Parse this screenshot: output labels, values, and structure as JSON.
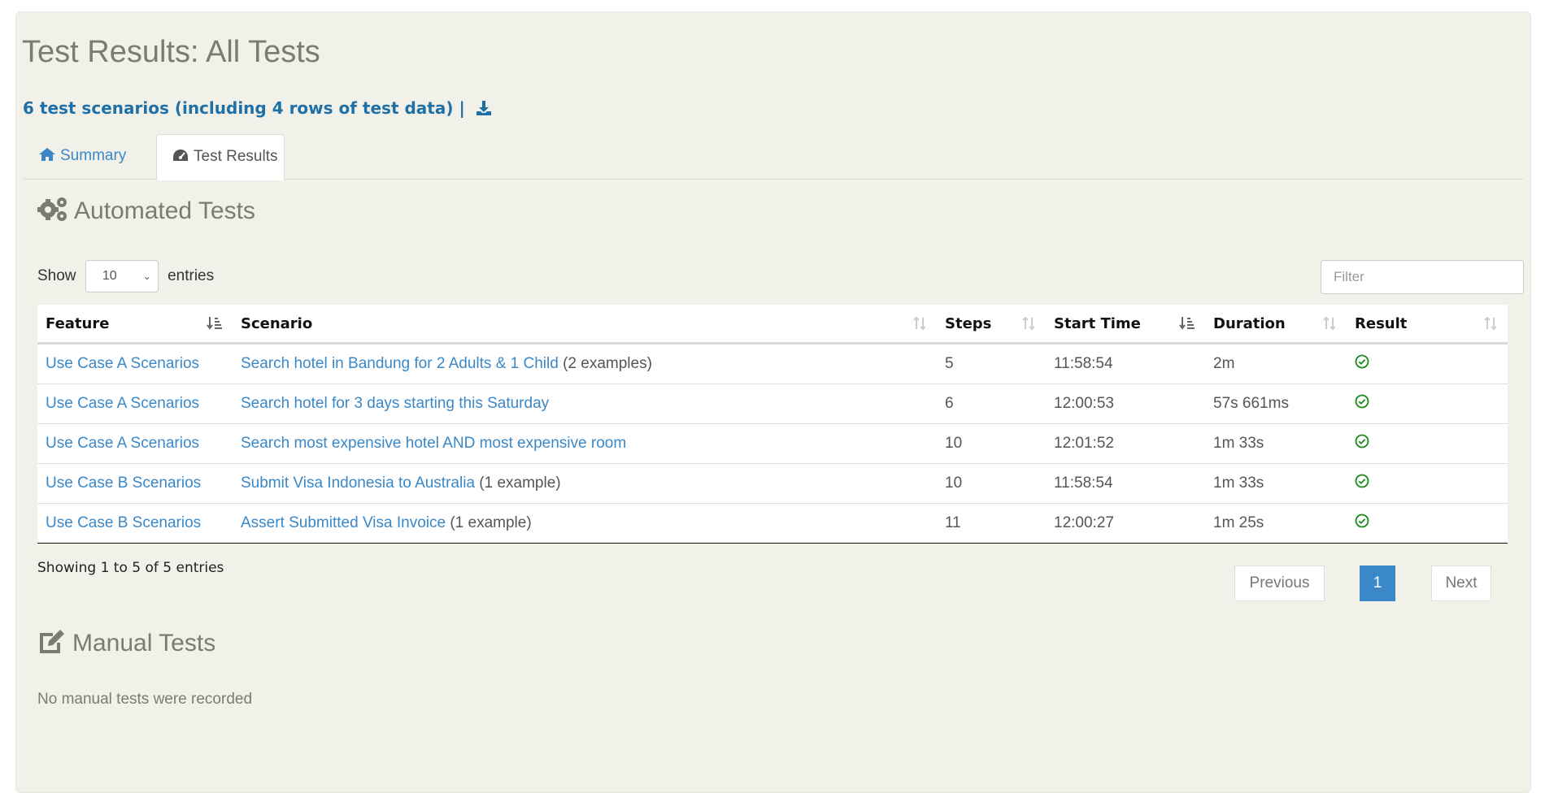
{
  "page": {
    "title": "Test Results: All Tests",
    "summary_line": "6 test scenarios (including 4 rows of test data) |"
  },
  "tabs": [
    {
      "label": "Summary",
      "icon": "home-icon",
      "active": false
    },
    {
      "label": "Test Results",
      "icon": "dashboard-icon",
      "active": true
    }
  ],
  "automated": {
    "title": "Automated Tests",
    "show_label": "Show",
    "entries_label": "entries",
    "page_size": "10",
    "filter_placeholder": "Filter",
    "columns": [
      "Feature",
      "Scenario",
      "Steps",
      "Start Time",
      "Duration",
      "Result"
    ],
    "rows": [
      {
        "feature": "Use Case A Scenarios",
        "scenario": "Search hotel in Bandung for 2 Adults & 1 Child",
        "examples": "(2 examples)",
        "steps": "5",
        "start": "11:58:54",
        "duration": "2m",
        "result": "passed"
      },
      {
        "feature": "Use Case A Scenarios",
        "scenario": "Search hotel for 3 days starting this Saturday",
        "examples": "",
        "steps": "6",
        "start": "12:00:53",
        "duration": "57s 661ms",
        "result": "passed"
      },
      {
        "feature": "Use Case A Scenarios",
        "scenario": "Search most expensive hotel AND most expensive room",
        "examples": "",
        "steps": "10",
        "start": "12:01:52",
        "duration": "1m 33s",
        "result": "passed"
      },
      {
        "feature": "Use Case B Scenarios",
        "scenario": "Submit Visa Indonesia to Australia",
        "examples": "(1 example)",
        "steps": "10",
        "start": "11:58:54",
        "duration": "1m 33s",
        "result": "passed"
      },
      {
        "feature": "Use Case B Scenarios",
        "scenario": "Assert Submitted Visa Invoice",
        "examples": "(1 example)",
        "steps": "11",
        "start": "12:00:27",
        "duration": "1m 25s",
        "result": "passed"
      }
    ],
    "showing_text": "Showing 1 to 5 of 5 entries",
    "pagination": {
      "previous": "Previous",
      "current": "1",
      "next": "Next"
    }
  },
  "manual": {
    "title": "Manual Tests",
    "empty_text": "No manual tests were recorded"
  },
  "colors": {
    "link": "#3a88c8",
    "heading": "#7b7b73",
    "pass": "#1a8a1a",
    "panel": "#f1f1e9"
  }
}
